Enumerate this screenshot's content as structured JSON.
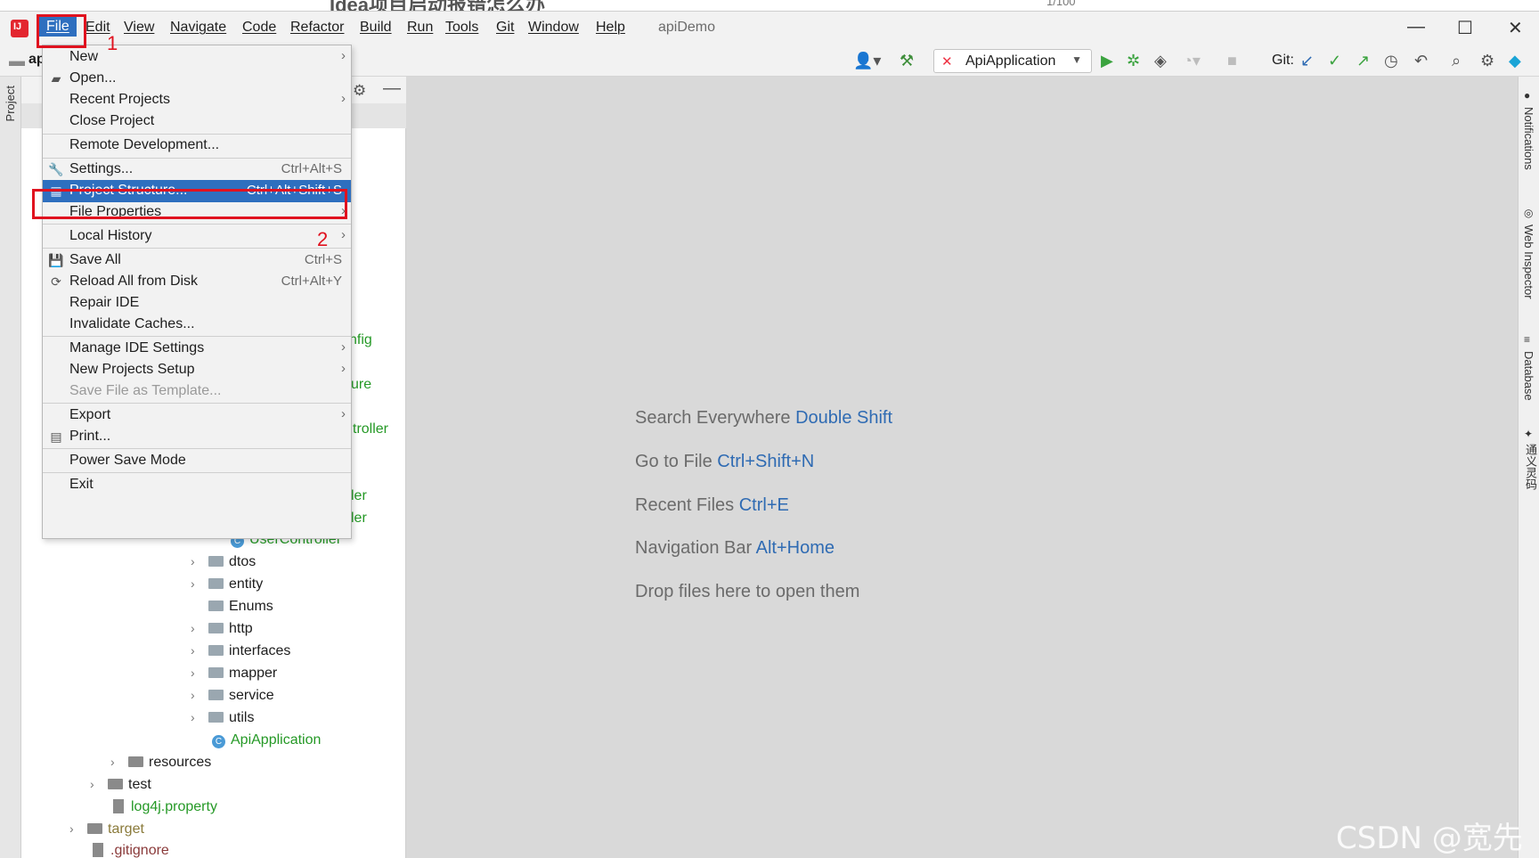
{
  "page_top": {
    "cut_text": "Idea项目启动报错怎么办",
    "cut_number": "1/100"
  },
  "menubar": {
    "items": [
      "File",
      "Edit",
      "View",
      "Navigate",
      "Code",
      "Refactor",
      "Build",
      "Run",
      "Tools",
      "Git",
      "Window",
      "Help"
    ],
    "project_title": "apiDemo",
    "window_controls": {
      "minimize": "—",
      "maximize": "☐",
      "close": "✕"
    }
  },
  "toolbar": {
    "breadcrumb_partial": "ap",
    "run_config": "ApiApplication",
    "git_label": "Git:"
  },
  "left_strip": {
    "project_label": "Project"
  },
  "file_menu": {
    "items": [
      {
        "label": "New",
        "shortcut": "",
        "submenu": true,
        "icon": ""
      },
      {
        "label": "Open...",
        "shortcut": "",
        "submenu": false,
        "icon": "folder-icon"
      },
      {
        "label": "Recent Projects",
        "shortcut": "",
        "submenu": true,
        "icon": ""
      },
      {
        "label": "Close Project",
        "shortcut": "",
        "submenu": false,
        "icon": ""
      },
      {
        "label": "Remote Development...",
        "shortcut": "",
        "submenu": false,
        "icon": ""
      },
      {
        "label": "Settings...",
        "shortcut": "Ctrl+Alt+S",
        "submenu": false,
        "icon": "wrench-icon"
      },
      {
        "label": "Project Structure...",
        "shortcut": "Ctrl+Alt+Shift+S",
        "submenu": false,
        "icon": "project-structure-icon",
        "selected": true
      },
      {
        "label": "File Properties",
        "shortcut": "",
        "submenu": true,
        "icon": ""
      },
      {
        "label": "Local History",
        "shortcut": "",
        "submenu": true,
        "icon": ""
      },
      {
        "label": "Save All",
        "shortcut": "Ctrl+S",
        "submenu": false,
        "icon": "save-icon"
      },
      {
        "label": "Reload All from Disk",
        "shortcut": "Ctrl+Alt+Y",
        "submenu": false,
        "icon": "reload-icon"
      },
      {
        "label": "Repair IDE",
        "shortcut": "",
        "submenu": false,
        "icon": ""
      },
      {
        "label": "Invalidate Caches...",
        "shortcut": "",
        "submenu": false,
        "icon": ""
      },
      {
        "label": "Manage IDE Settings",
        "shortcut": "",
        "submenu": true,
        "icon": ""
      },
      {
        "label": "New Projects Setup",
        "shortcut": "",
        "submenu": true,
        "icon": ""
      },
      {
        "label": "Save File as Template...",
        "shortcut": "",
        "submenu": false,
        "icon": "",
        "disabled": true
      },
      {
        "label": "Export",
        "shortcut": "",
        "submenu": true,
        "icon": ""
      },
      {
        "label": "Print...",
        "shortcut": "",
        "submenu": false,
        "icon": "print-icon"
      },
      {
        "label": "Power Save Mode",
        "shortcut": "",
        "submenu": false,
        "icon": ""
      },
      {
        "label": "Exit",
        "shortcut": "",
        "submenu": false,
        "icon": ""
      }
    ]
  },
  "project_tree": {
    "peeks": [
      "nfig",
      "ure",
      "troller",
      "ler",
      "ler"
    ],
    "rows": [
      {
        "label": "UserController",
        "kind": "class"
      },
      {
        "label": "dtos",
        "kind": "folder"
      },
      {
        "label": "entity",
        "kind": "folder"
      },
      {
        "label": "Enums",
        "kind": "folder"
      },
      {
        "label": "http",
        "kind": "folder"
      },
      {
        "label": "interfaces",
        "kind": "folder"
      },
      {
        "label": "mapper",
        "kind": "folder"
      },
      {
        "label": "service",
        "kind": "folder"
      },
      {
        "label": "utils",
        "kind": "folder"
      },
      {
        "label": "ApiApplication",
        "kind": "class"
      },
      {
        "label": "resources",
        "kind": "folder"
      },
      {
        "label": "test",
        "kind": "folder"
      },
      {
        "label": "log4j.property",
        "kind": "file"
      },
      {
        "label": "target",
        "kind": "folder"
      },
      {
        "label": ".gitignore",
        "kind": "file"
      }
    ]
  },
  "editor_hints": [
    {
      "text": "Search Everywhere",
      "key": "Double Shift"
    },
    {
      "text": "Go to File",
      "key": "Ctrl+Shift+N"
    },
    {
      "text": "Recent Files",
      "key": "Ctrl+E"
    },
    {
      "text": "Navigation Bar",
      "key": "Alt+Home"
    },
    {
      "text": "Drop files here to open them",
      "key": ""
    }
  ],
  "right_strip": {
    "labels": [
      "Notifications",
      "Web Inspector",
      "Database",
      "通义灵码"
    ]
  },
  "annotations": {
    "one": "1",
    "two": "2"
  },
  "watermark": "CSDN @宽先生",
  "colors": {
    "selection": "#2e6fbf",
    "annotation_red": "#e0121f",
    "green_text": "#259926",
    "key_blue": "#2f6bb3"
  }
}
